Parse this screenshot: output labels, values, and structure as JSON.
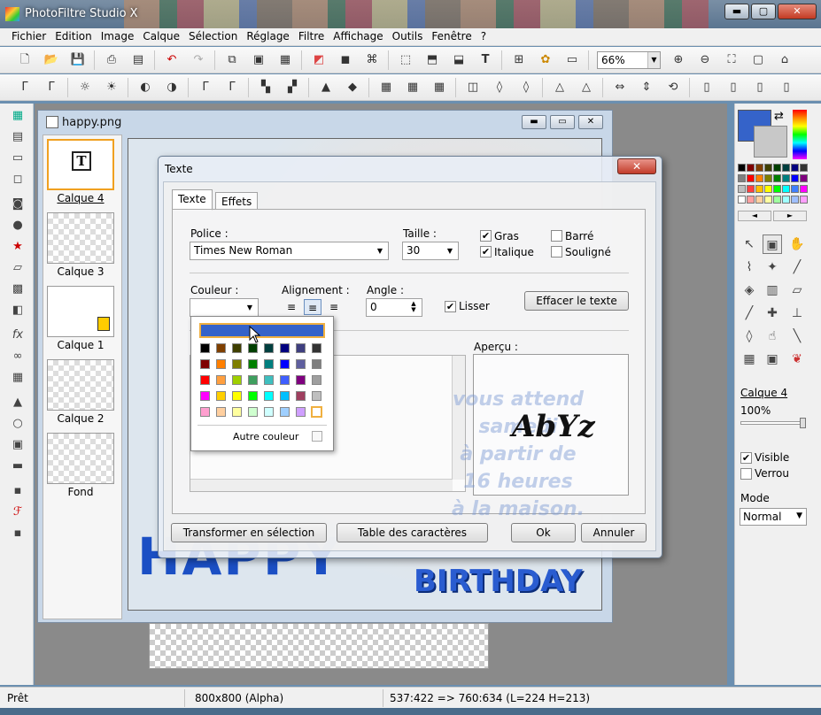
{
  "app": {
    "title": "PhotoFiltre Studio X"
  },
  "window_buttons": {
    "minimize": "▬",
    "maximize": "▢",
    "close": "✕"
  },
  "menu": [
    "Fichier",
    "Edition",
    "Image",
    "Calque",
    "Sélection",
    "Réglage",
    "Filtre",
    "Affichage",
    "Outils",
    "Fenêtre",
    "?"
  ],
  "toolbar": {
    "zoom_value": "66%"
  },
  "document": {
    "title": "happy.png"
  },
  "layers": [
    {
      "label": "Calque 4",
      "selected": true
    },
    {
      "label": "Calque 3"
    },
    {
      "label": "Calque 1"
    },
    {
      "label": "Calque 2"
    },
    {
      "label": "Fond"
    }
  ],
  "canvas": {
    "happy": "HAPPY",
    "birthday": "BIRTHDAY"
  },
  "dialog": {
    "title": "Texte",
    "close": "✕",
    "tabs": [
      "Texte",
      "Effets"
    ],
    "police_label": "Police :",
    "police_value": "Times New Roman",
    "taille_label": "Taille :",
    "taille_value": "30",
    "gras": "Gras",
    "italique": "Italique",
    "barre": "Barré",
    "souligne": "Souligné",
    "couleur_label": "Couleur :",
    "alignement_label": "Alignement :",
    "angle_label": "Angle :",
    "angle_value": "0",
    "lisser": "Lisser",
    "effacer": "Effacer le texte",
    "apercu_label": "Aperçu :",
    "preview_text": "AbYz",
    "overlay_lines": [
      "vous attend",
      "samedi",
      "à partir de",
      "16 heures",
      "à la maison."
    ],
    "autre_couleur": "Autre couleur",
    "btn_transformer": "Transformer en sélection",
    "btn_table": "Table des caractères",
    "btn_ok": "Ok",
    "btn_annuler": "Annuler",
    "checks": {
      "gras": true,
      "italique": true,
      "barre": false,
      "souligne": false,
      "lisser": true
    }
  },
  "right_panel": {
    "layer_name": "Calque 4",
    "opacity": "100%",
    "visible_label": "Visible",
    "verrou_label": "Verrou",
    "mode_label": "Mode",
    "mode_value": "Normal"
  },
  "status": {
    "state": "Prêt",
    "size": "800x800 (Alpha)",
    "coords": "537:422 => 760:634 (L=224  H=213)"
  },
  "colors": {
    "foreground": "#3563c9",
    "background": "#c8c8c8",
    "popup_selected": "#3563c9"
  }
}
